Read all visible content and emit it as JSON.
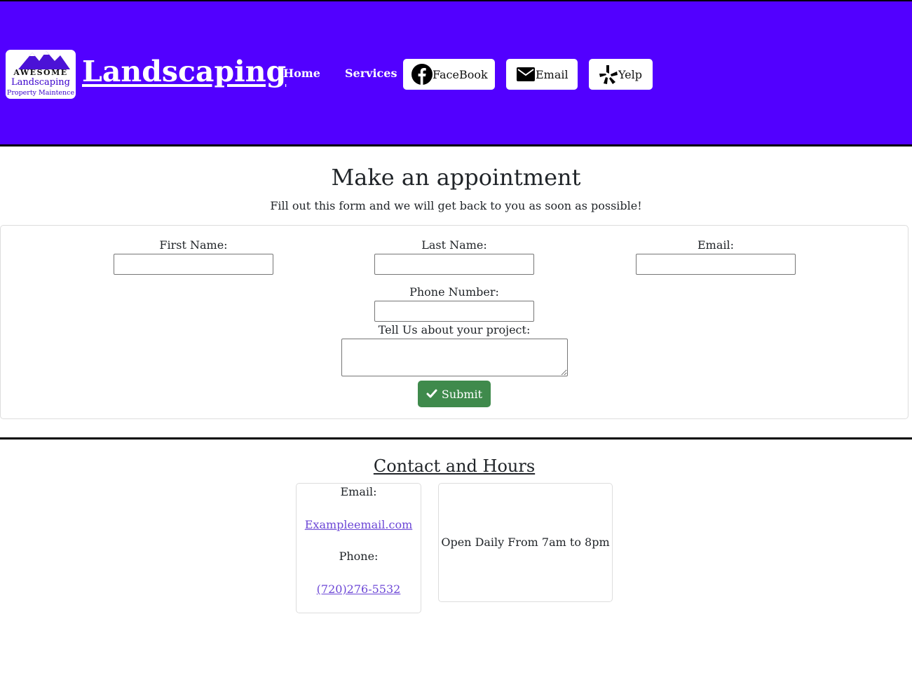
{
  "header": {
    "logo": {
      "line1": "AWESOME",
      "line2": "Landscaping",
      "line3": "Property Maintence"
    },
    "brand": "Landscaping",
    "nav": {
      "home": "Home",
      "services": "Services"
    },
    "social": {
      "facebook": "FaceBook",
      "email": "Email",
      "yelp": "Yelp"
    },
    "colors": {
      "background": "#5200ff"
    }
  },
  "appointment": {
    "title": "Make an appointment",
    "subtitle": "Fill out this form and we will get back to you as soon as possible!",
    "fields": {
      "first_name": {
        "label": "First Name:",
        "value": ""
      },
      "last_name": {
        "label": "Last Name:",
        "value": ""
      },
      "email": {
        "label": "Email:",
        "value": ""
      },
      "phone": {
        "label": "Phone Number:",
        "value": ""
      },
      "project": {
        "label": "Tell Us about your project:",
        "value": ""
      }
    },
    "submit_label": "Submit",
    "submit_color": "#3f8a4c"
  },
  "contact": {
    "title": "Contact and Hours",
    "email_label": "Email:",
    "email_value": "Exampleemail.com",
    "phone_label": "Phone:",
    "phone_value": "(720)276-5532",
    "hours": "Open Daily From 7am to 8pm"
  }
}
